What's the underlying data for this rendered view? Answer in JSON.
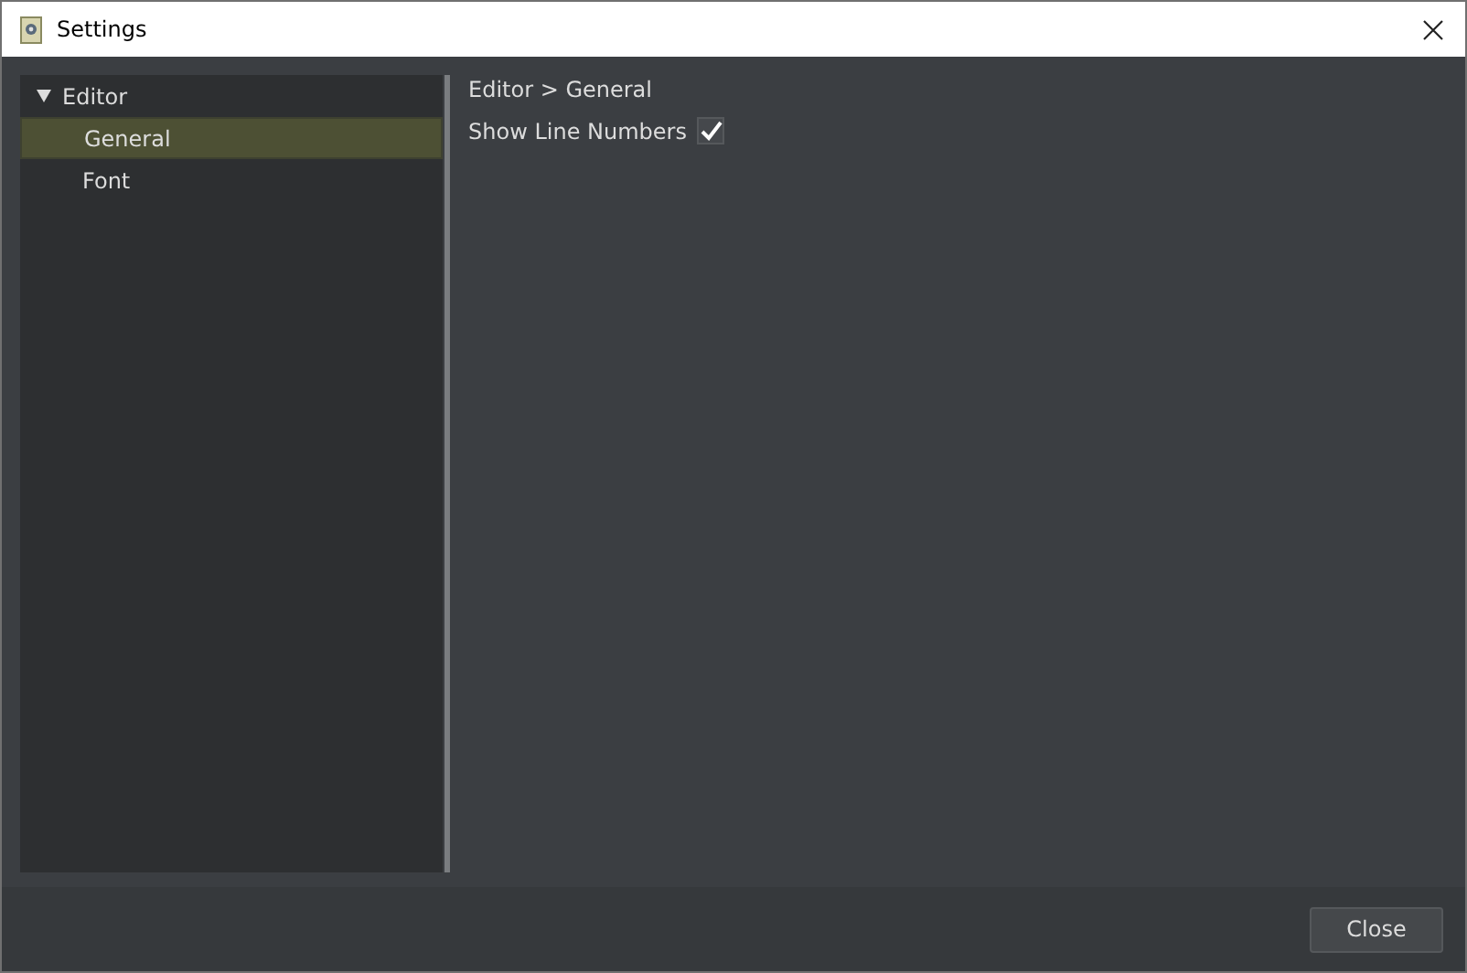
{
  "window": {
    "title": "Settings"
  },
  "sidebar": {
    "items": [
      {
        "label": "Editor",
        "expanded": true,
        "selected": false,
        "children": [
          {
            "label": "General",
            "selected": true
          },
          {
            "label": "Font",
            "selected": false
          }
        ]
      }
    ]
  },
  "breadcrumb": "Editor > General",
  "options": [
    {
      "kind": "checkbox",
      "label": "Show Line Numbers",
      "checked": true
    }
  ],
  "buttons": [
    "Close"
  ]
}
